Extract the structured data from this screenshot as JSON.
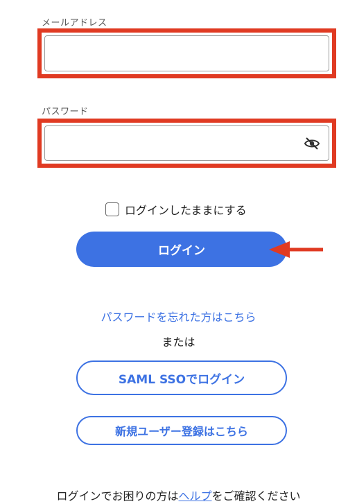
{
  "form": {
    "email_label": "メールアドレス",
    "email_value": "",
    "password_label": "パスワード",
    "password_value": "",
    "password_toggle_icon": "eye-off-icon",
    "remember_label": "ログインしたままにする",
    "remember_checked": false,
    "login_label": "ログイン",
    "forgot_link": "パスワードを忘れた方はこちら",
    "or_label": "または",
    "saml_label": "SAML SSOでログイン",
    "register_label": "新規ユーザー登録はこちら"
  },
  "footer": {
    "text_before": "ログインでお困りの方は",
    "help_link": "ヘルプ",
    "text_after": "をご確認ください"
  },
  "annotations": {
    "highlight_color": "#e03a22",
    "arrow_icon": "left-arrow-icon"
  },
  "colors": {
    "accent": "#3d72e3"
  }
}
